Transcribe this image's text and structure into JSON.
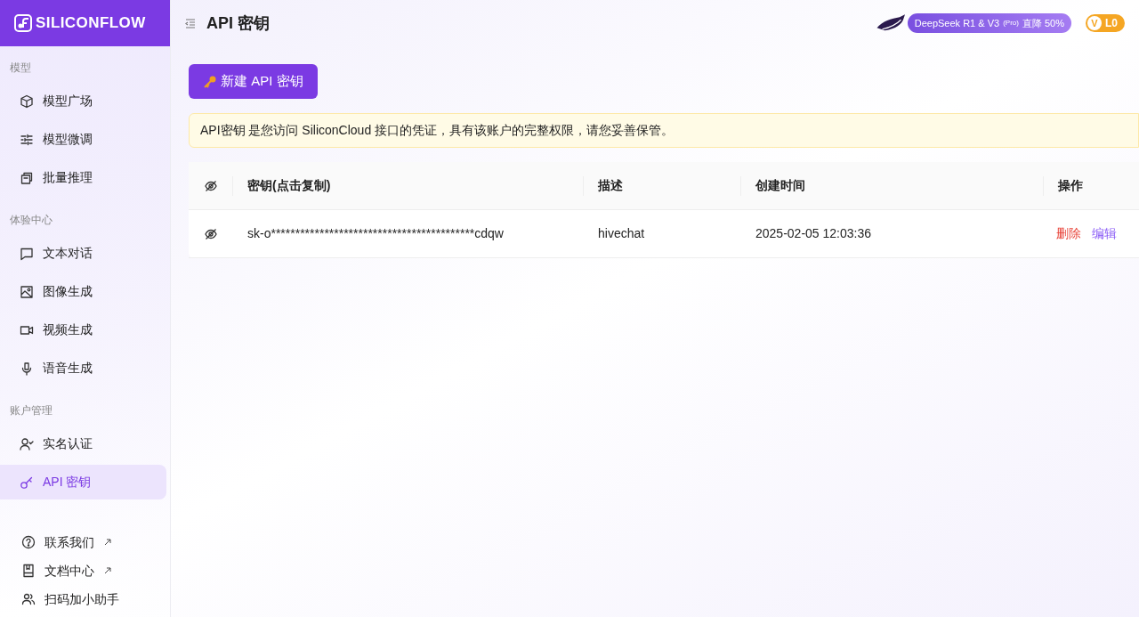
{
  "logo": {
    "text": "SILICONFLOW"
  },
  "page_title": "API 密钥",
  "promo_banner": {
    "text": "DeepSeek R1 & V3",
    "tag": "(Pro)",
    "offer": "直降 50%"
  },
  "level_badge": {
    "letter": "V",
    "text": "L0"
  },
  "sidebar": {
    "sections": [
      {
        "title": "模型",
        "items": [
          {
            "label": "模型广场",
            "selected": false
          },
          {
            "label": "模型微调",
            "selected": false
          },
          {
            "label": "批量推理",
            "selected": false
          }
        ]
      },
      {
        "title": "体验中心",
        "items": [
          {
            "label": "文本对话",
            "selected": false
          },
          {
            "label": "图像生成",
            "selected": false
          },
          {
            "label": "视频生成",
            "selected": false
          },
          {
            "label": "语音生成",
            "selected": false
          }
        ]
      },
      {
        "title": "账户管理",
        "items": [
          {
            "label": "实名认证",
            "selected": false
          },
          {
            "label": "API 密钥",
            "selected": true
          }
        ]
      }
    ],
    "footer_links": [
      {
        "label": "联系我们",
        "external": true
      },
      {
        "label": "文档中心",
        "external": true
      },
      {
        "label": "扫码加小助手",
        "external": false
      }
    ]
  },
  "new_key_button": "新建 API 密钥",
  "notice": "API密钥 是您访问 SiliconCloud 接口的凭证，具有该账户的完整权限，请您妥善保管。",
  "table": {
    "columns": [
      "密钥(点击复制)",
      "描述",
      "创建时间",
      "操作"
    ],
    "rows": [
      {
        "key": "sk-o******************************************cdqw",
        "description": "hivechat",
        "created": "2025-02-05 12:03:36",
        "actions": [
          {
            "label": "删除",
            "kind": "danger"
          },
          {
            "label": "编辑",
            "kind": "primary"
          }
        ]
      }
    ]
  }
}
